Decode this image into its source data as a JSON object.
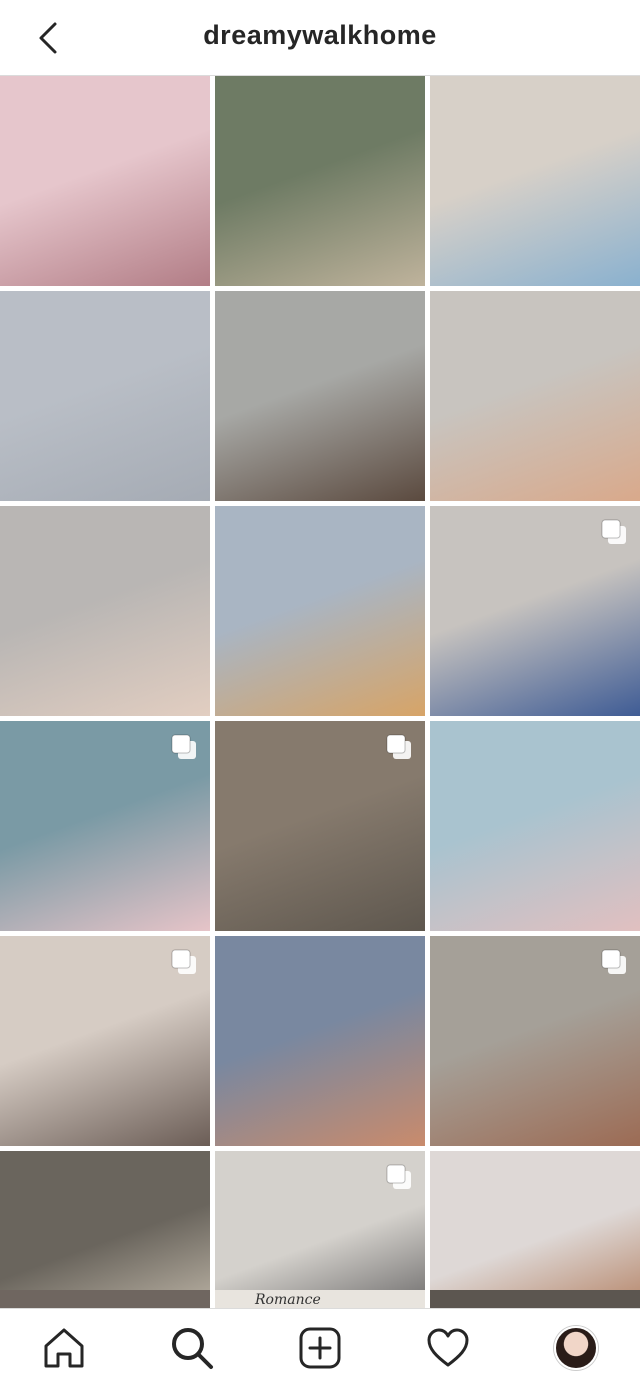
{
  "header": {
    "username": "dreamywalkhome",
    "back_icon": "chevron-left-icon"
  },
  "grid": {
    "tiles": [
      {
        "name": "post-pink-dress-dog",
        "colors": [
          "#e6c6cc",
          "#b27d86"
        ],
        "multi": false
      },
      {
        "name": "post-swans-lake",
        "colors": [
          "#6e7b64",
          "#bfb39c"
        ],
        "multi": false
      },
      {
        "name": "post-blue-underwear",
        "colors": [
          "#d7d0c8",
          "#8ab1cf"
        ],
        "multi": false
      },
      {
        "name": "post-moon-crane",
        "colors": [
          "#b9bec6",
          "#a5abb4"
        ],
        "multi": false
      },
      {
        "name": "post-cinema",
        "colors": [
          "#a7a8a5",
          "#5b4a3f"
        ],
        "multi": false
      },
      {
        "name": "post-mural-rose",
        "colors": [
          "#c8c4bf",
          "#d9a98b"
        ],
        "multi": false
      },
      {
        "name": "post-white-lingerie",
        "colors": [
          "#b9b6b4",
          "#e2cec1"
        ],
        "multi": false
      },
      {
        "name": "post-sunset-building",
        "colors": [
          "#a9b5c3",
          "#d7a467"
        ],
        "multi": false
      },
      {
        "name": "post-blue-dress",
        "colors": [
          "#c7c3bf",
          "#3f5c95"
        ],
        "multi": true
      },
      {
        "name": "post-outline-skincare",
        "colors": [
          "#7a9aa5",
          "#e6c4c8"
        ],
        "multi": true
      },
      {
        "name": "post-concrete-wall",
        "colors": [
          "#867a6d",
          "#5e574e"
        ],
        "multi": true
      },
      {
        "name": "post-books-sunglasses",
        "colors": [
          "#a9c3cf",
          "#e1c0c0"
        ],
        "multi": false
      },
      {
        "name": "post-sheer-bra",
        "colors": [
          "#d6ccc4",
          "#6b5d56"
        ],
        "multi": true
      },
      {
        "name": "post-tree-sunset",
        "colors": [
          "#7988a0",
          "#c98b6c"
        ],
        "multi": false
      },
      {
        "name": "post-red-top-stairs",
        "colors": [
          "#a5a098",
          "#9c6b54"
        ],
        "multi": true
      },
      {
        "name": "post-candle-notebook",
        "colors": [
          "#6a655d",
          "#e1d7c6"
        ],
        "multi": false
      },
      {
        "name": "post-back-corset",
        "colors": [
          "#d4d1cc",
          "#3c3b3d"
        ],
        "multi": true
      },
      {
        "name": "post-sandals-mirror",
        "colors": [
          "#ded8d6",
          "#a25d34"
        ],
        "multi": false
      }
    ],
    "partial_row_text": "Romance"
  },
  "nav": {
    "items": [
      {
        "name": "home-icon"
      },
      {
        "name": "search-icon"
      },
      {
        "name": "new-post-icon"
      },
      {
        "name": "activity-heart-icon"
      },
      {
        "name": "profile-avatar"
      }
    ]
  }
}
